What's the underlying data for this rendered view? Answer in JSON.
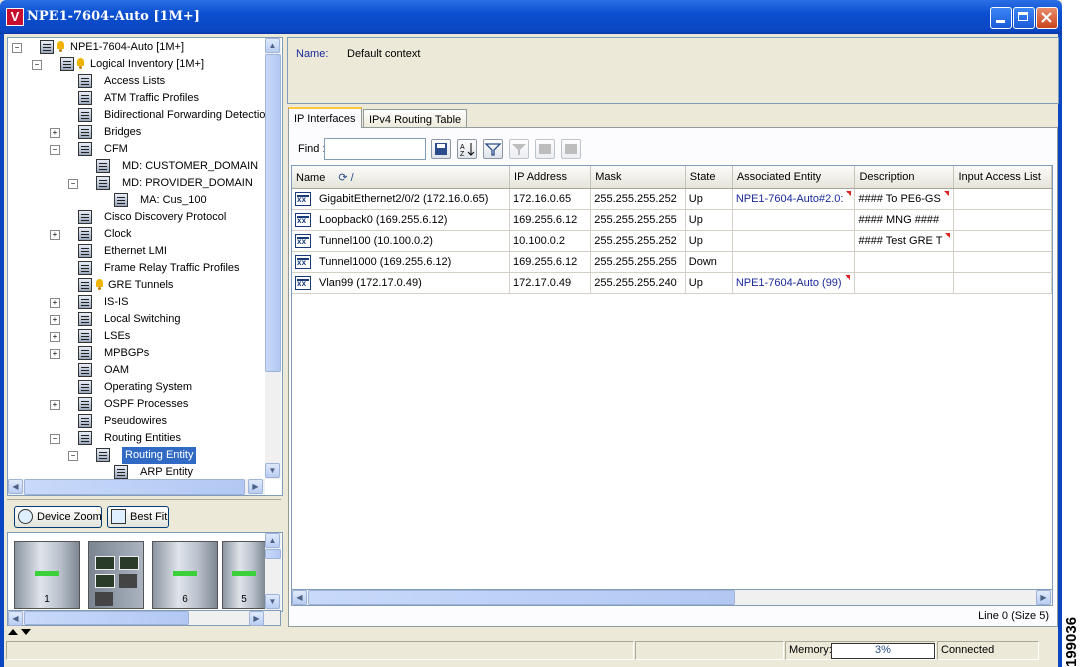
{
  "window": {
    "title": "NPE1-7604-Auto [1M+]",
    "logo": "V"
  },
  "tree": {
    "items": [
      {
        "label": "NPE1-7604-Auto [1M+]",
        "level": 0,
        "expander": "-"
      },
      {
        "label": "Logical Inventory [1M+]",
        "level": 1,
        "expander": "-"
      },
      {
        "label": "Access Lists",
        "level": 2
      },
      {
        "label": "ATM Traffic Profiles",
        "level": 2
      },
      {
        "label": "Bidirectional Forwarding Detection",
        "level": 2
      },
      {
        "label": "Bridges",
        "level": 2,
        "expander": "+"
      },
      {
        "label": "CFM",
        "level": 2,
        "expander": "-"
      },
      {
        "label": "MD: CUSTOMER_DOMAIN",
        "level": 3
      },
      {
        "label": "MD: PROVIDER_DOMAIN",
        "level": 3,
        "expander": "-"
      },
      {
        "label": "MA: Cus_100",
        "level": 4
      },
      {
        "label": "Cisco Discovery Protocol",
        "level": 2
      },
      {
        "label": "Clock",
        "level": 2,
        "expander": "+"
      },
      {
        "label": "Ethernet LMI",
        "level": 2
      },
      {
        "label": "Frame Relay Traffic Profiles",
        "level": 2
      },
      {
        "label": "GRE Tunnels",
        "level": 2
      },
      {
        "label": "IS-IS",
        "level": 2,
        "expander": "+"
      },
      {
        "label": "Local Switching",
        "level": 2,
        "expander": "+"
      },
      {
        "label": "LSEs",
        "level": 2,
        "expander": "+"
      },
      {
        "label": "MPBGPs",
        "level": 2,
        "expander": "+"
      },
      {
        "label": "OAM",
        "level": 2
      },
      {
        "label": "Operating System",
        "level": 2
      },
      {
        "label": "OSPF Processes",
        "level": 2,
        "expander": "+"
      },
      {
        "label": "Pseudowires",
        "level": 2
      },
      {
        "label": "Routing Entities",
        "level": 2,
        "expander": "-"
      },
      {
        "label": "Routing Entity",
        "level": 3,
        "expander": "-",
        "selected": true
      },
      {
        "label": "ARP Entity",
        "level": 4
      }
    ]
  },
  "buttons": {
    "device_zoom": "Device Zoom",
    "best_fit": "Best Fit"
  },
  "chassis": {
    "slots": [
      "1",
      "",
      "6",
      "5"
    ]
  },
  "details": {
    "name_label": "Name:",
    "name_value": "Default context"
  },
  "tabs": [
    {
      "label": "IP Interfaces",
      "active": true
    },
    {
      "label": "IPv4 Routing Table",
      "active": false
    }
  ],
  "find": {
    "label": "Find :",
    "value": ""
  },
  "table": {
    "columns": [
      "Name",
      "IP Address",
      "Mask",
      "State",
      "Associated Entity",
      "Description",
      "Input Access List"
    ],
    "rows": [
      [
        "GigabitEthernet2/0/2 (172.16.0.65)",
        "172.16.0.65",
        "255.255.255.252",
        "Up",
        "NPE1-7604-Auto#2.0:",
        "#### To PE6-GS",
        ""
      ],
      [
        "Loopback0 (169.255.6.12)",
        "169.255.6.12",
        "255.255.255.255",
        "Up",
        "",
        "#### MNG ####",
        ""
      ],
      [
        "Tunnel100 (10.100.0.2)",
        "10.100.0.2",
        "255.255.255.252",
        "Up",
        "",
        "#### Test GRE T",
        ""
      ],
      [
        "Tunnel1000 (169.255.6.12)",
        "169.255.6.12",
        "255.255.255.255",
        "Down",
        "",
        "",
        ""
      ],
      [
        "Vlan99 (172.17.0.49)",
        "172.17.0.49",
        "255.255.255.240",
        "Up",
        "NPE1-7604-Auto (99)",
        "",
        ""
      ]
    ],
    "truncated": {
      "0.4": true,
      "0.5": true,
      "2.5": true,
      "4.4": true
    },
    "footer": "Line 0 (Size 5)"
  },
  "statusbar": {
    "memory_label": "Memory:",
    "memory_value": "3%",
    "connection": "Connected"
  },
  "side_number": "199036"
}
